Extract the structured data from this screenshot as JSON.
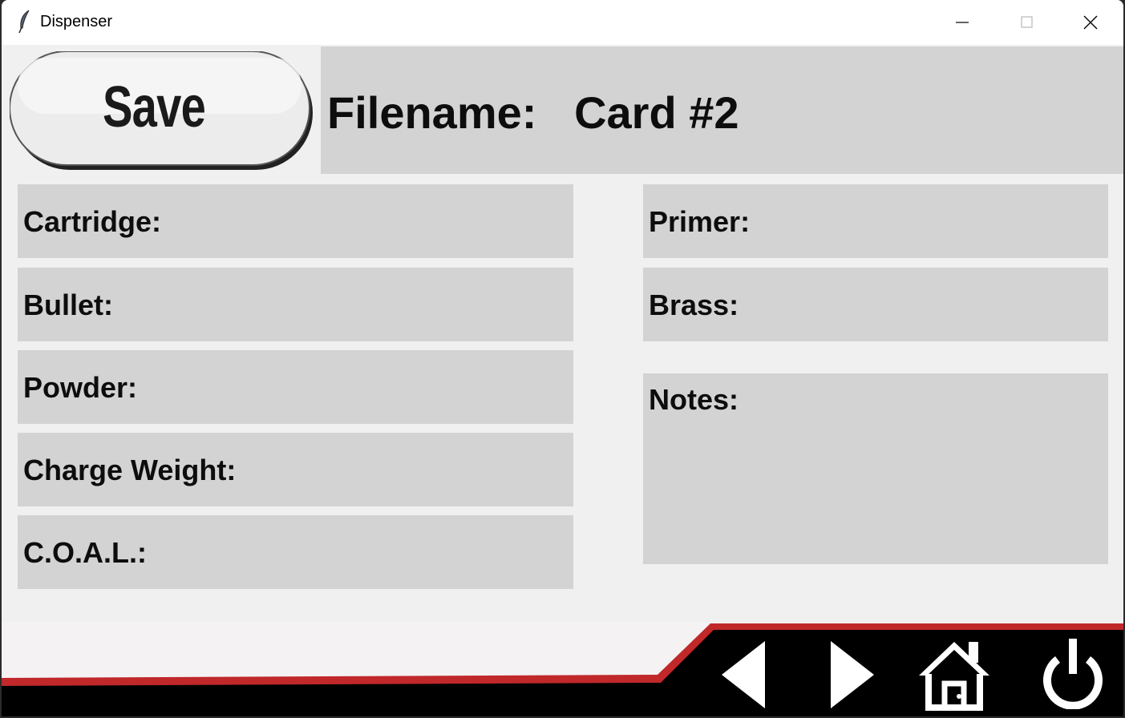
{
  "window": {
    "title": "Dispenser"
  },
  "save_button": {
    "label": "Save"
  },
  "filename": {
    "label": "Filename:",
    "value": "Card #2"
  },
  "fields_left": [
    {
      "label": "Cartridge:"
    },
    {
      "label": "Bullet:"
    },
    {
      "label": "Powder:"
    },
    {
      "label": "Charge Weight:"
    },
    {
      "label": "C.O.A.L.:"
    }
  ],
  "fields_right": [
    {
      "label": "Primer:"
    },
    {
      "label": "Brass:"
    },
    {
      "label": "Notes:"
    }
  ],
  "colors": {
    "panel": "#d3d3d3",
    "background": "#f0f0f0",
    "accent_red": "#c0282a",
    "footer_black": "#000000"
  },
  "nav_icons": [
    "back-arrow-icon",
    "forward-arrow-icon",
    "home-icon",
    "power-icon"
  ]
}
